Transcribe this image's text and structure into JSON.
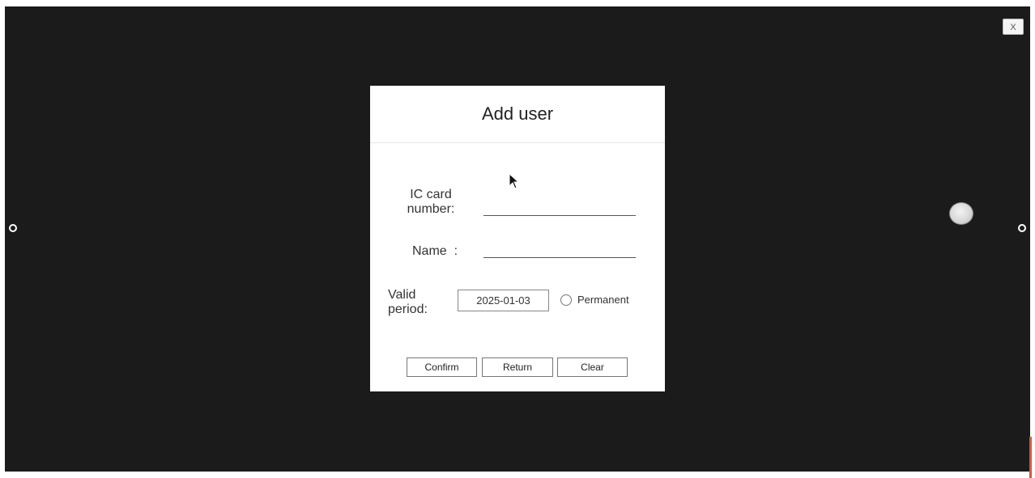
{
  "window": {
    "close_label": "X"
  },
  "dialog": {
    "title": "Add user",
    "fields": {
      "ic_card_label": "IC card\nnumber:",
      "ic_card_value": "",
      "name_label": "Name  :",
      "name_value": "",
      "valid_period_label": "Valid\nperiod:",
      "valid_period_date": "2025-01-03",
      "permanent_label": "Permanent",
      "permanent_checked": false
    },
    "buttons": {
      "confirm": "Confirm",
      "return": "Return",
      "clear": "Clear"
    }
  },
  "colors": {
    "screen_background": "#1b1b1b",
    "dialog_background": "#ffffff",
    "scroll_indicator": "#d25a3c"
  },
  "icons": [
    "close-icon",
    "edge-handle-icon",
    "floating-assistive-ball-icon",
    "mouse-pointer-icon",
    "radio-icon"
  ]
}
